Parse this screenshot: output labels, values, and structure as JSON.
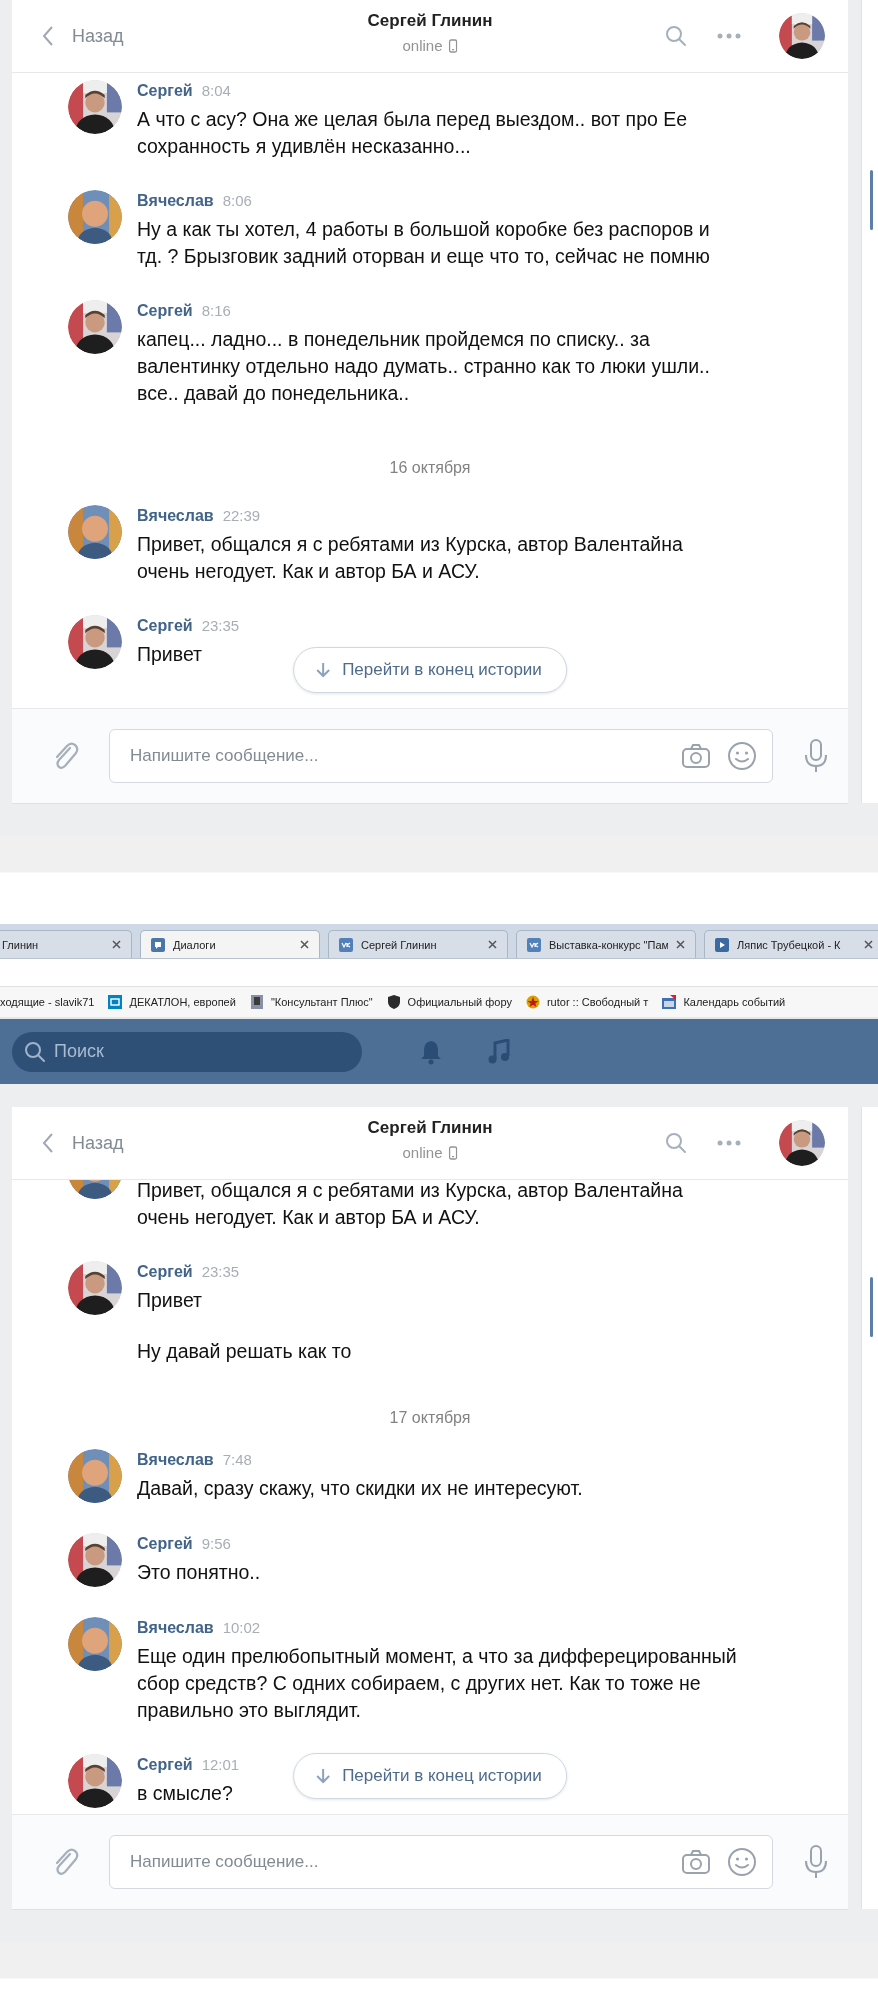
{
  "screens": [
    {
      "header": {
        "back": "Назад",
        "title": "Сергей Глинин",
        "status": "online"
      },
      "items": [
        {
          "kind": "message",
          "author": "Сергей",
          "contact": true,
          "time": "8:04",
          "texts": [
            "А что с асу? Она же целая была перед выездом.. вот про Ее сохранность я удивлён несказанно..."
          ]
        },
        {
          "kind": "message",
          "author": "Вячеслав",
          "contact": false,
          "time": "8:06",
          "texts": [
            "Ну а как ты хотел, 4 работы в большой коробке без распоров и тд. ? Брызговик задний оторван и еще что то, сейчас не помню"
          ]
        },
        {
          "kind": "message",
          "author": "Сергей",
          "contact": true,
          "time": "8:16",
          "texts": [
            "капец... ладно... в понедельник пройдемся по списку.. за валентинку отдельно надо думать.. странно как то люки ушли.. все.. давай до понедельника.."
          ]
        },
        {
          "kind": "date",
          "text": "16 октября"
        },
        {
          "kind": "message",
          "author": "Вячеслав",
          "contact": false,
          "time": "22:39",
          "texts": [
            "Привет, общался я с ребятами из Курска, автор Валентайна очень негодует. Как и автор БА и АСУ."
          ]
        },
        {
          "kind": "message",
          "author": "Сергей",
          "contact": true,
          "time": "23:35",
          "texts": [
            "Привет"
          ]
        }
      ],
      "jump_button": "Перейти в конец истории",
      "composer": {
        "placeholder": "Напишите сообщение..."
      }
    },
    {
      "browser": {
        "tabs": [
          {
            "title": "Глинин",
            "selected": false
          },
          {
            "title": "Диалоги",
            "selected": true
          },
          {
            "title": "Сергей Глинин",
            "selected": false
          },
          {
            "title": "Выставка-конкурс \"Пам",
            "selected": false
          },
          {
            "title": "Ляпис Трубецкой - К",
            "selected": false
          }
        ],
        "bookmarks": [
          {
            "title": "ходящие - slavik71"
          },
          {
            "title": "ДЕКАТЛОН, европей"
          },
          {
            "title": "\"Консультант Плюс\""
          },
          {
            "title": "Официальный фору"
          },
          {
            "title": "rutor :: Свободный т"
          },
          {
            "title": "Календарь событий"
          }
        ]
      },
      "topbar": {
        "search": {
          "placeholder": "Поиск"
        }
      },
      "header": {
        "back": "Назад",
        "title": "Сергей Глинин",
        "status": "online"
      },
      "items": [
        {
          "kind": "message",
          "contact": false,
          "texts": [
            "Привет, общался я с ребятами из Курска, автор Валентайна очень негодует. Как и автор БА и АСУ."
          ]
        },
        {
          "kind": "message",
          "author": "Сергей",
          "contact": true,
          "time": "23:35",
          "texts": [
            "Привет",
            "Ну давай решать как то"
          ]
        },
        {
          "kind": "date",
          "text": "17 октября"
        },
        {
          "kind": "message",
          "author": "Вячеслав",
          "contact": false,
          "time": "7:48",
          "texts": [
            "Давай, сразу скажу, что скидки их не интересуют."
          ]
        },
        {
          "kind": "message",
          "author": "Сергей",
          "contact": true,
          "time": "9:56",
          "texts": [
            "Это понятно.."
          ]
        },
        {
          "kind": "message",
          "author": "Вячеслав",
          "contact": false,
          "time": "10:02",
          "texts": [
            "Еще один прелюбопытный момент, а что за дифферецированный сбор средств? С одних собираем, с других нет. Как то тоже не правильно это выглядит."
          ]
        },
        {
          "kind": "message",
          "author": "Сергей",
          "contact": true,
          "time": "12:01",
          "texts": [
            "в смысле?"
          ]
        }
      ],
      "jump_button": "Перейти в конец истории",
      "composer": {
        "placeholder": "Напишите сообщение..."
      }
    }
  ]
}
